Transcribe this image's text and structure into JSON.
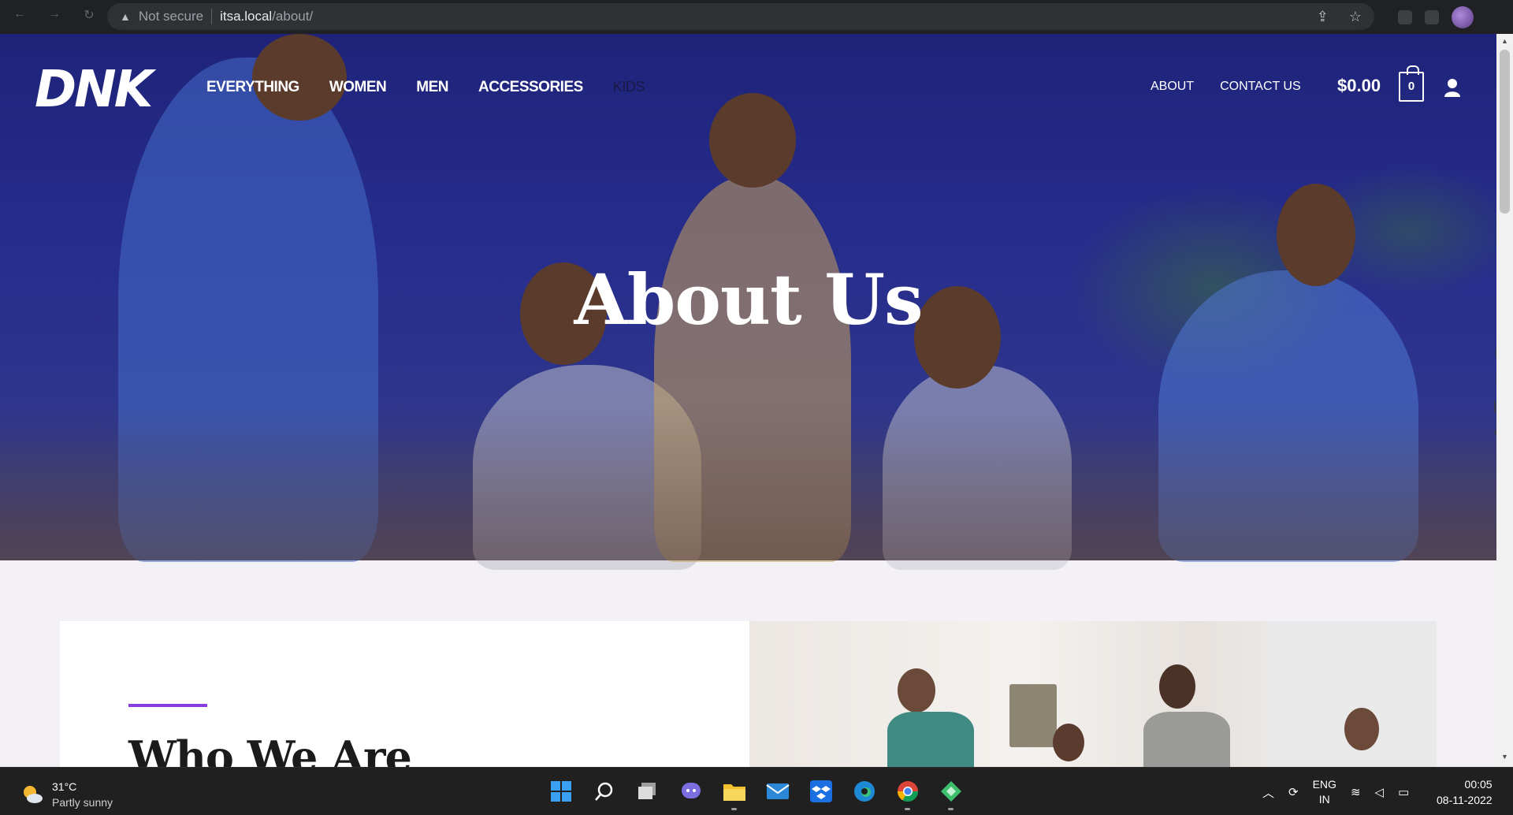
{
  "browser": {
    "security_label": "Not secure",
    "url_host": "itsa.local",
    "url_path": "/about/"
  },
  "site": {
    "logo": "DNK",
    "main_nav": [
      "EVERYTHING",
      "WOMEN",
      "MEN",
      "ACCESSORIES",
      "KIDS"
    ],
    "secondary_nav": [
      "ABOUT",
      "CONTACT US"
    ],
    "cart_total": "$0.00",
    "cart_count": "0"
  },
  "hero": {
    "title": "About Us"
  },
  "section": {
    "title": "Who We Are",
    "accent_color": "#8a3dde"
  },
  "taskbar": {
    "weather_temp": "31°C",
    "weather_desc": "Partly sunny",
    "lang_top": "ENG",
    "lang_bottom": "IN",
    "time": "00:05",
    "date": "08-11-2022",
    "apps": [
      "start-icon",
      "search-icon",
      "task-view-icon",
      "chat-icon",
      "file-explorer-icon",
      "mail-icon",
      "dropbox-icon",
      "edge-icon",
      "chrome-icon",
      "app-icon"
    ]
  },
  "colors": {
    "hero_overlay": "#26318c",
    "taskbar_bg": "#202020"
  }
}
